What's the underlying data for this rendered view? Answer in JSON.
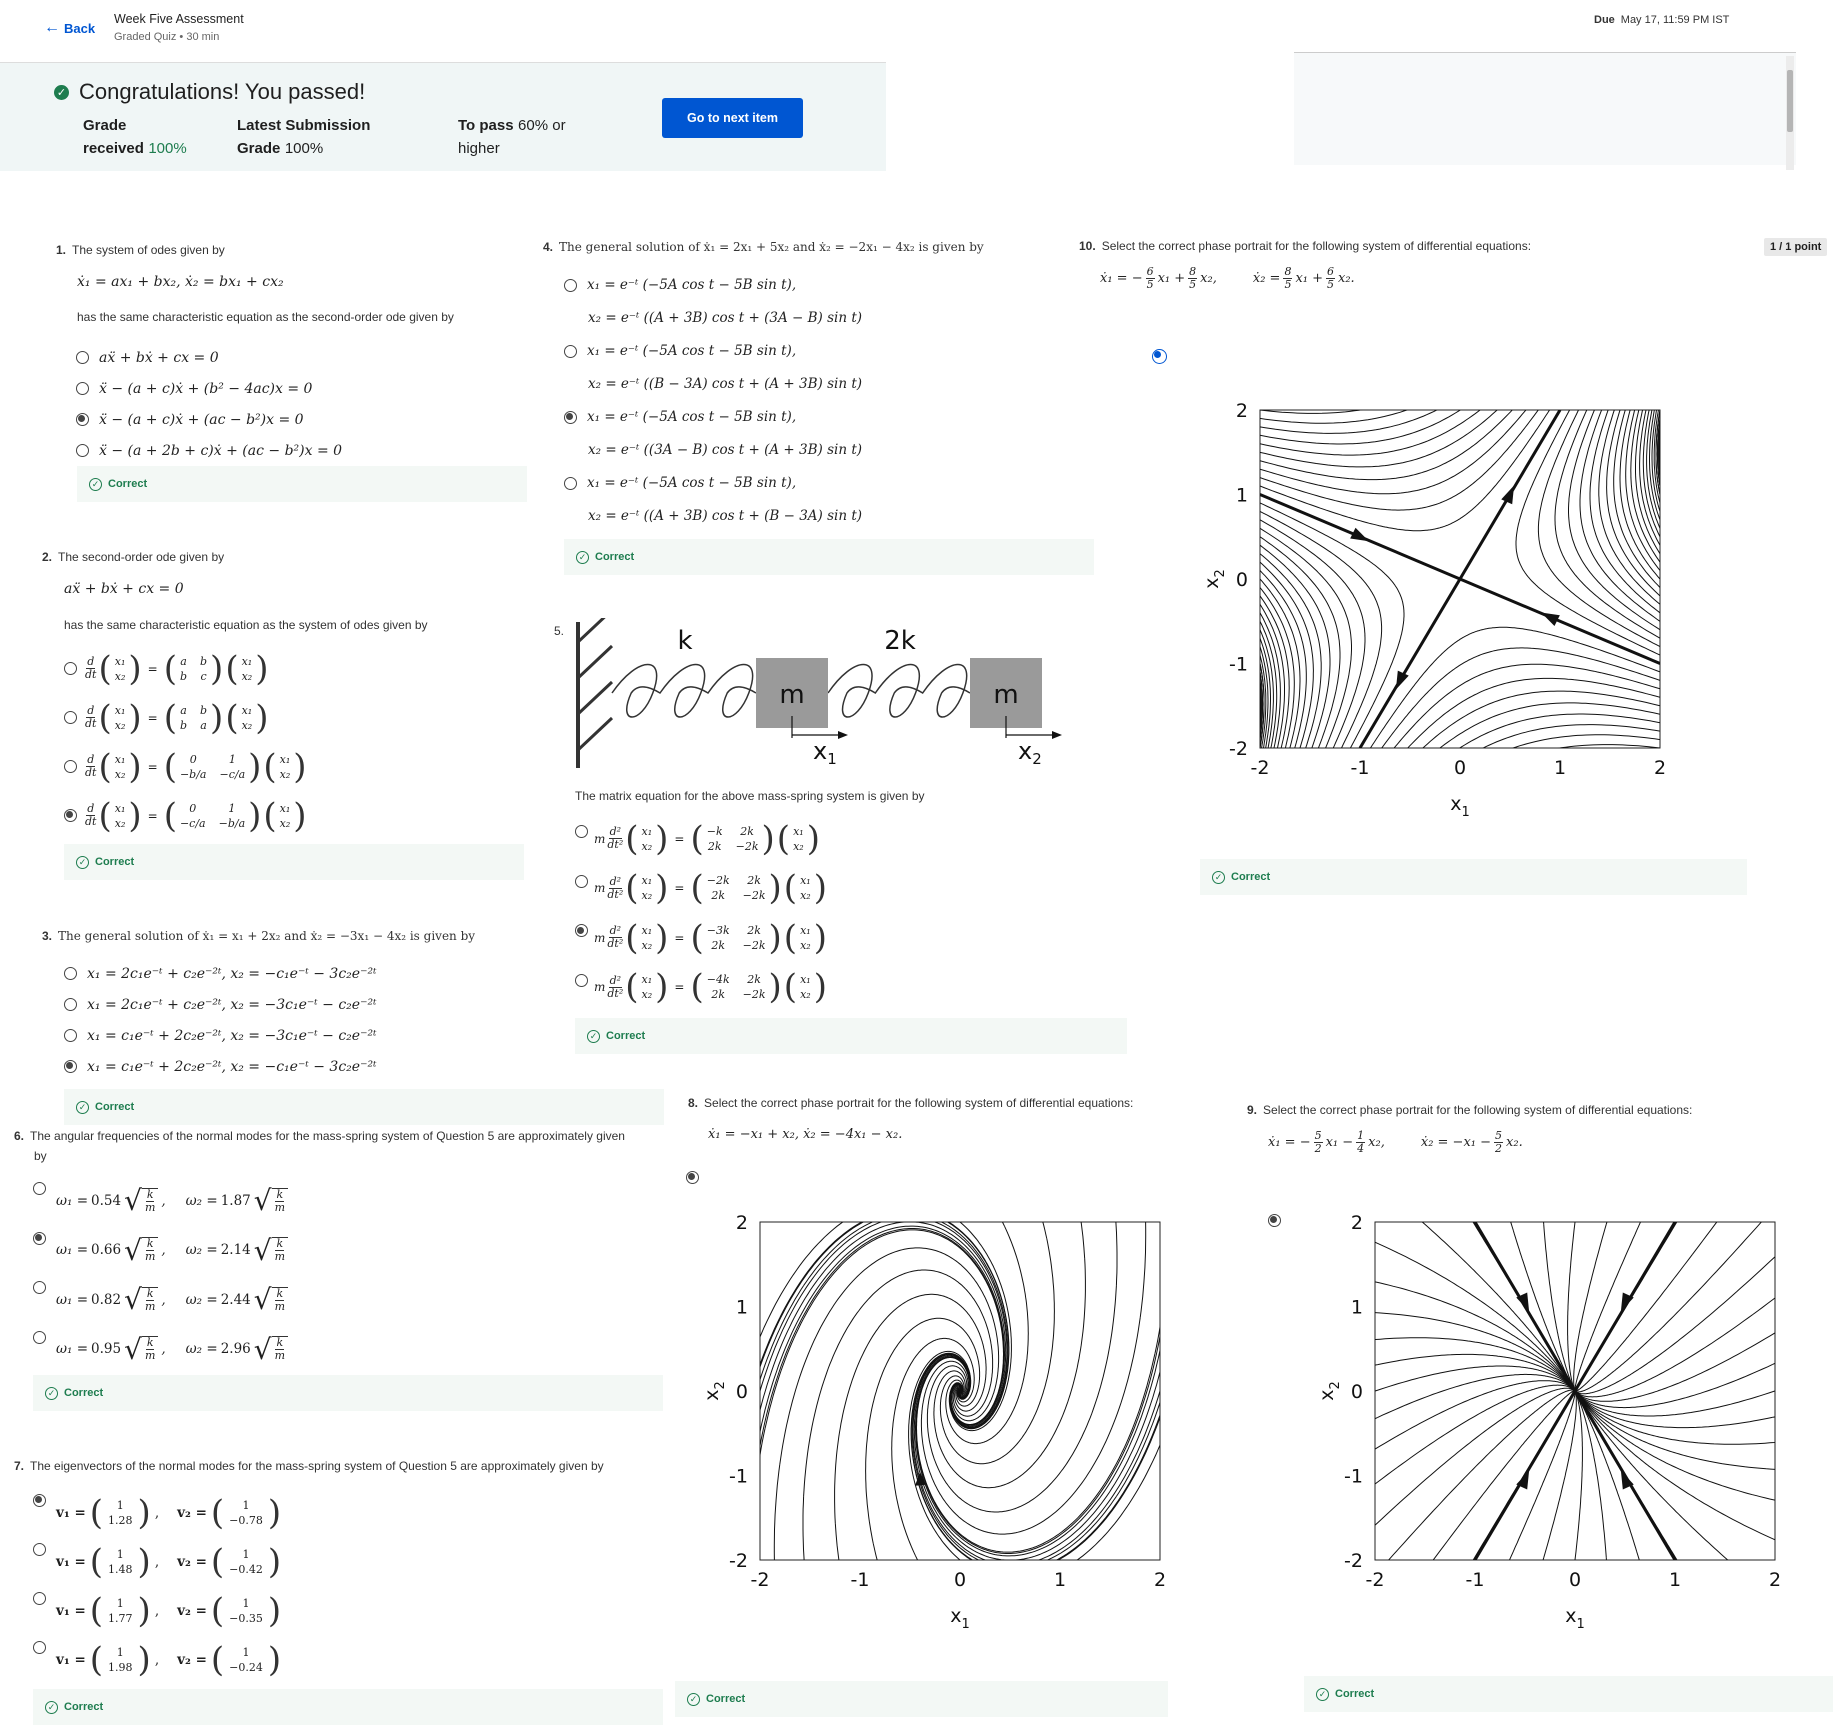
{
  "header": {
    "back_label": "Back",
    "quiz_title": "Week Five Assessment",
    "quiz_sub": "Graded Quiz • 30 min",
    "due_label": "Due",
    "due_value": "May 17, 11:59 PM IST"
  },
  "result": {
    "congrats": "Congratulations! You passed!",
    "grade_label1": "Grade",
    "grade_label2": "received",
    "grade_value": "100%",
    "latest_label": "Latest Submission",
    "latest_label2": "Grade",
    "latest_value": "100%",
    "pass_label": "To pass",
    "pass_value": "60% or",
    "pass_value2": "higher",
    "next_button": "Go to next item"
  },
  "correct_label": "Correct",
  "point_badge": "1 / 1 point",
  "q1": {
    "num": "1.",
    "text": "The system of odes given by",
    "eq": "ẋ₁ = ax₁ + bx₂,        ẋ₂ = bx₁ + cx₂",
    "text2": "has the same characteristic equation as the second-order ode given by",
    "options": [
      "aẍ + bẋ + cx = 0",
      "ẍ − (a + c)ẋ + (b² − 4ac)x = 0",
      "ẍ − (a + c)ẋ + (ac − b²)x = 0",
      "ẍ − (a + 2b + c)ẋ + (ac − b²)x = 0"
    ],
    "selected": 2
  },
  "q2": {
    "num": "2.",
    "text": "The second-order ode given by",
    "eq": "aẍ + bẋ + cx = 0",
    "text2": "has the same characteristic equation as the system of odes given by",
    "options": [
      {
        "m11": "a",
        "m12": "b",
        "m21": "b",
        "m22": "c"
      },
      {
        "m11": "a",
        "m12": "b",
        "m21": "b",
        "m22": "a"
      },
      {
        "m11": "0",
        "m12": "1",
        "m21": "−b/a",
        "m22": "−c/a"
      },
      {
        "m11": "0",
        "m12": "1",
        "m21": "−c/a",
        "m22": "−b/a"
      }
    ],
    "d": "d",
    "dt": "dt",
    "x1": "x₁",
    "x2": "x₂",
    "selected": 3
  },
  "q3": {
    "num": "3.",
    "text": "The general solution of ẋ₁ = x₁ + 2x₂ and ẋ₂ = −3x₁ − 4x₂ is given by",
    "options": [
      "x₁ = 2c₁e⁻ᵗ + c₂e⁻²ᵗ,    x₂ = −c₁e⁻ᵗ − 3c₂e⁻²ᵗ",
      "x₁ = 2c₁e⁻ᵗ + c₂e⁻²ᵗ,    x₂ = −3c₁e⁻ᵗ − c₂e⁻²ᵗ",
      "x₁ = c₁e⁻ᵗ + 2c₂e⁻²ᵗ,    x₂ = −3c₁e⁻ᵗ − c₂e⁻²ᵗ",
      "x₁ = c₁e⁻ᵗ + 2c₂e⁻²ᵗ,    x₂ = −c₁e⁻ᵗ − 3c₂e⁻²ᵗ"
    ],
    "selected": 3
  },
  "q4": {
    "num": "4.",
    "text": "The general solution of ẋ₁ = 2x₁ + 5x₂ and ẋ₂ = −2x₁ − 4x₂ is given by",
    "options": [
      {
        "a": "x₁ = e⁻ᵗ (−5A cos t − 5B sin t),",
        "b": "x₂ = e⁻ᵗ ((A + 3B) cos t + (3A − B) sin t)"
      },
      {
        "a": "x₁ = e⁻ᵗ (−5A cos t − 5B sin t),",
        "b": "x₂ = e⁻ᵗ ((B − 3A) cos t + (A + 3B) sin t)"
      },
      {
        "a": "x₁ = e⁻ᵗ (−5A cos t − 5B sin t),",
        "b": "x₂ = e⁻ᵗ ((3A − B) cos t + (A + 3B) sin t)"
      },
      {
        "a": "x₁ = e⁻ᵗ (−5A cos t − 5B sin t),",
        "b": "x₂ = e⁻ᵗ ((A + 3B) cos t + (B − 3A) sin t)"
      }
    ],
    "selected": 2
  },
  "q5": {
    "num": "5.",
    "spring1": "k",
    "spring2": "2k",
    "mass": "m",
    "x1": "x",
    "x1sub": "1",
    "x2": "x",
    "x2sub": "2",
    "text": "The matrix equation for the above mass-spring system is given by",
    "m": "m",
    "d2": "d²",
    "dt2": "dt²",
    "vx1": "x₁",
    "vx2": "x₂",
    "options": [
      {
        "m11": "−k",
        "m12": "2k",
        "m21": "2k",
        "m22": "−2k"
      },
      {
        "m11": "−2k",
        "m12": "2k",
        "m21": "2k",
        "m22": "−2k"
      },
      {
        "m11": "−3k",
        "m12": "2k",
        "m21": "2k",
        "m22": "−2k"
      },
      {
        "m11": "−4k",
        "m12": "2k",
        "m21": "2k",
        "m22": "−2k"
      }
    ],
    "selected": 2
  },
  "q6": {
    "num": "6.",
    "text": "The  angular frequencies of the normal modes for the mass-spring system of Question 5 are approximately given",
    "text2": "by",
    "w1": "ω₁ =",
    "w2": "ω₂ =",
    "k": "k",
    "m": "m",
    "options": [
      {
        "a": "0.54",
        "b": "1.87"
      },
      {
        "a": "0.66",
        "b": "2.14"
      },
      {
        "a": "0.82",
        "b": "2.44"
      },
      {
        "a": "0.95",
        "b": "2.96"
      }
    ],
    "selected": 1
  },
  "q7": {
    "num": "7.",
    "text": "The eigenvectors of the normal modes for the mass-spring system of Question 5 are approximately given by",
    "v1": "v₁ =",
    "v2": "v₂ =",
    "top": "1",
    "options": [
      {
        "a": "1.28",
        "b": "−0.78"
      },
      {
        "a": "1.48",
        "b": "−0.42"
      },
      {
        "a": "1.77",
        "b": "−0.35"
      },
      {
        "a": "1.98",
        "b": "−0.24"
      }
    ],
    "selected": 0
  },
  "q8": {
    "num": "8.",
    "text": "Select the correct phase portrait for the following system of differential equations:",
    "eq": "ẋ₁ = −x₁ + x₂,        ẋ₂ = −4x₁ − x₂."
  },
  "q9": {
    "num": "9.",
    "text": "Select the correct phase portrait for the following system of differential equations:",
    "eq1": "ẋ₁ = −",
    "eq1b": "x₁ −",
    "eq1c": "x₂,",
    "eq2": "ẋ₂ = −x₁ −",
    "eq2b": "x₂.",
    "f1n": "5",
    "f1d": "2",
    "f2n": "1",
    "f2d": "4",
    "f3n": "5",
    "f3d": "2"
  },
  "q10": {
    "num": "10.",
    "text": "Select the correct phase portrait for the following system of differential equations:",
    "eq1": "ẋ₁ = −",
    "eq1b": "x₁ +",
    "eq1c": "x₂,",
    "eq2": "ẋ₂ =",
    "eq2b": "x₁ +",
    "eq2c": "x₂.",
    "f1n": "6",
    "f1d": "5",
    "f2n": "8",
    "f2d": "5",
    "f3n": "8",
    "f3d": "5",
    "f4n": "6",
    "f4d": "5"
  },
  "plot_axes": {
    "xticks": [
      "-2",
      "-1",
      "0",
      "1",
      "2"
    ],
    "yticks": [
      "2",
      "1",
      "0",
      "-1",
      "-2"
    ],
    "xlabel": "x",
    "xlabel_sub": "1",
    "ylabel": "x",
    "ylabel_sub": "2"
  },
  "colors": {
    "accent": "#0056d2",
    "success": "#1e7d4f",
    "banner": "#f0f6f6"
  }
}
